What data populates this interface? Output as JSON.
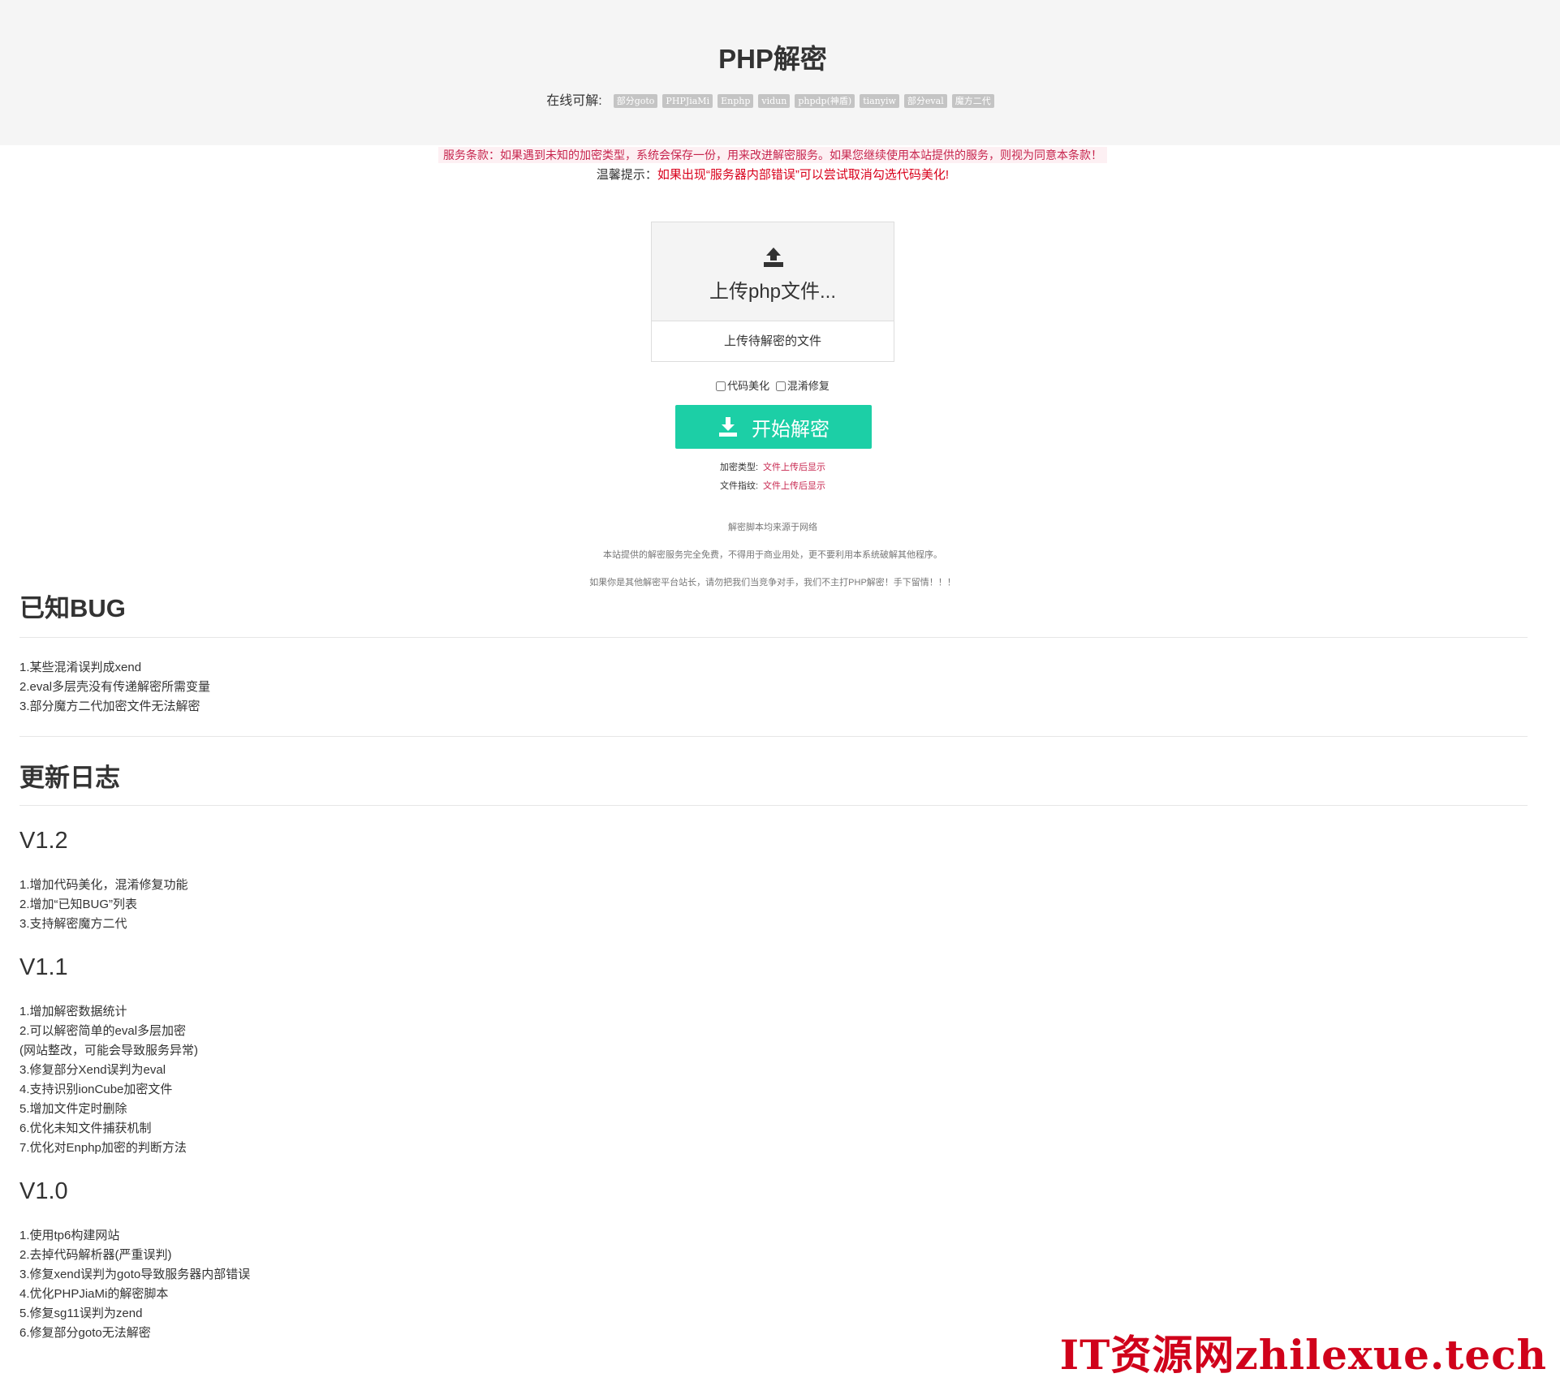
{
  "header": {
    "title": "PHP解密",
    "supported_label": "在线可解:",
    "tags": [
      "部分goto",
      "PHPJiaMi",
      "Enphp",
      "vidun",
      "phpdp(神盾)",
      "tianyiw",
      "部分eval",
      "魔方二代"
    ]
  },
  "notices": {
    "terms": "服务条款：如果遇到未知的加密类型，系统会保存一份，用来改进解密服务。如果您继续使用本站提供的服务，则视为同意本条款！",
    "tip_label": "温馨提示：",
    "tip_text": "如果出现“服务器内部错误”可以尝试取消勾选代码美化!"
  },
  "upload": {
    "title": "上传php文件...",
    "subtitle": "上传待解密的文件"
  },
  "options": {
    "beautify_label": "代码美化",
    "deobfuscate_label": "混淆修复"
  },
  "decrypt_button": "开始解密",
  "meta": {
    "type_label": "加密类型:",
    "type_value": "文件上传后显示",
    "fingerprint_label": "文件指纹:",
    "fingerprint_value": "文件上传后显示"
  },
  "disclaimers": [
    "解密脚本均来源于网络",
    "本站提供的解密服务完全免费，不得用于商业用处，更不要利用本系统破解其他程序。",
    "如果你是其他解密平台站长，请勿把我们当竞争对手，我们不主打PHP解密！手下留情！！！"
  ],
  "known_bugs": {
    "heading": "已知BUG",
    "items": [
      "1.某些混淆误判成xend",
      "2.eval多层壳没有传递解密所需变量",
      "3.部分魔方二代加密文件无法解密"
    ]
  },
  "changelog": {
    "heading": "更新日志",
    "versions": [
      {
        "version": "V1.2",
        "items": [
          "1.增加代码美化，混淆修复功能",
          "2.增加“已知BUG”列表",
          "3.支持解密魔方二代"
        ]
      },
      {
        "version": "V1.1",
        "items": [
          "1.增加解密数据统计",
          "2.可以解密简单的eval多层加密",
          "(网站整改，可能会导致服务异常)",
          "3.修复部分Xend误判为eval",
          "4.支持识别ionCube加密文件",
          "5.增加文件定时删除",
          "6.优化未知文件捕获机制",
          "7.优化对Enphp加密的判断方法"
        ]
      },
      {
        "version": "V1.0",
        "items": [
          "1.使用tp6构建网站",
          "2.去掉代码解析器(严重误判)",
          "3.修复xend误判为goto导致服务器内部错误",
          "4.优化PHPJiaMi的解密脚本",
          "5.修复sg11误判为zend",
          "6.修复部分goto无法解密"
        ]
      }
    ]
  },
  "watermark": "IT资源网zhilexue.tech"
}
